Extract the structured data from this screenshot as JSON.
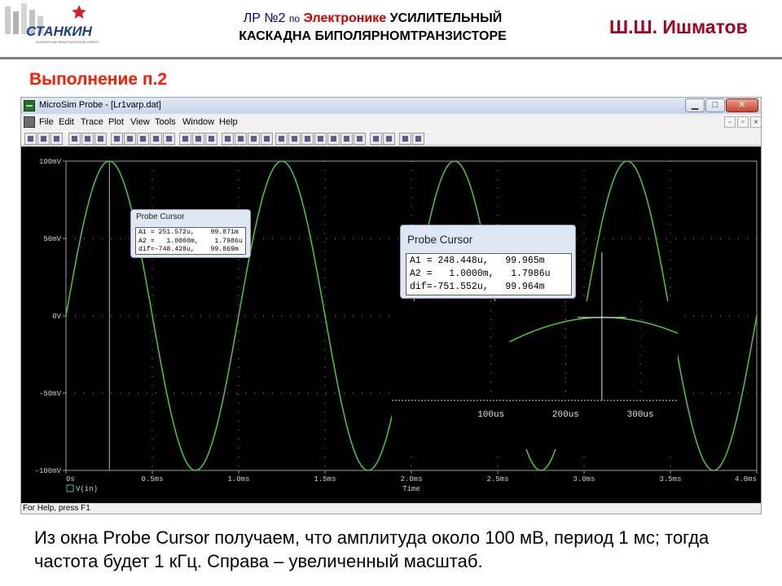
{
  "slide": {
    "logo_text": "СТАНКИН",
    "logo_sub": "МОСКОВСКИЙ ГОСУДАРСТВЕННЫЙ ТЕХНОЛОГИЧЕСКИЙ УНИВЕРСИТЕТ",
    "title_lab": "ЛР №2",
    "title_po": "по",
    "title_subject": "Электронике",
    "title_line1_rest": "УСИЛИТЕЛЬНЫЙ",
    "title_line2": "КАСКАДНА БИПОЛЯРНОМТРАНЗИСТОРЕ",
    "author": "Ш.Ш. Ишматов",
    "section_heading": "Выполнение п.2",
    "caption": "Из окна Probe Cursor получаем, что амплитуда около 100 мВ, период 1 мс; тогда частота будет 1 кГц. Справа – увеличенный масштаб."
  },
  "window": {
    "title": "MicroSim Probe - [Lr1varp.dat]",
    "menu": [
      "File",
      "Edit",
      "Trace",
      "Plot",
      "View",
      "Tools",
      "Window",
      "Help"
    ],
    "status": "For Help, press F1"
  },
  "colors": {
    "trace": "#4fc93a",
    "plot_bg": "#000000",
    "grid": "#9a9a9a",
    "title_red": "#cc0000",
    "author": "#a8001e",
    "heading": "#ff1a00"
  },
  "chart_data": {
    "type": "line",
    "xlabel": "Time",
    "x_tick_labels": [
      "0s",
      "0.5ms",
      "1.0ms",
      "1.5ms",
      "2.0ms",
      "2.5ms",
      "3.0ms",
      "3.5ms",
      "4.0ms"
    ],
    "y_tick_labels": [
      "100mV",
      "50mV",
      "0V",
      "-50mV",
      "-100mV"
    ],
    "xlim": [
      0,
      4.0
    ],
    "ylim": [
      -100,
      100
    ],
    "series": [
      {
        "name": "V(in)",
        "function": "sine",
        "amplitude_mV": 100,
        "period_ms": 1.0,
        "x_unit": "ms",
        "y_unit": "mV"
      }
    ],
    "cursor_x_ms": 0.2516,
    "zoom_inset": {
      "x_tick_labels": [
        "100us",
        "200us",
        "300us"
      ],
      "xlim_us": [
        0,
        350
      ],
      "cursor_x_us": 248.448
    }
  },
  "probe_cursor_small": {
    "title": "Probe Cursor",
    "rows": [
      "A1 = 251.572u,    99.871m",
      "A2 =   1.0000m,    1.7986u",
      "dif=-748.428u,    99.869m"
    ]
  },
  "probe_cursor_big": {
    "title": "Probe Cursor",
    "rows": [
      "A1 = 248.448u,   99.965m",
      "A2 =   1.0000m,   1.7986u",
      "dif=-751.552u,   99.964m"
    ]
  }
}
